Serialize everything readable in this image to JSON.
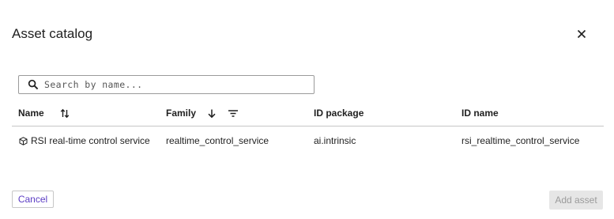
{
  "dialog": {
    "title": "Asset catalog",
    "close_icon": "close-icon"
  },
  "search": {
    "placeholder": "Search by name...",
    "value": "",
    "icon": "search-icon"
  },
  "table": {
    "columns": [
      {
        "label": "Name",
        "icon": "sort-both-icon"
      },
      {
        "label": "Family",
        "icons": [
          "arrow-down-icon",
          "filter-icon"
        ]
      },
      {
        "label": "ID package"
      },
      {
        "label": "ID name"
      }
    ],
    "rows": [
      {
        "icon": "cube-icon",
        "name": "RSI real-time control service",
        "family": "realtime_control_service",
        "id_package": "ai.intrinsic",
        "id_name": "rsi_realtime_control_service"
      }
    ]
  },
  "footer": {
    "cancel_label": "Cancel",
    "add_label": "Add asset"
  },
  "colors": {
    "accent": "#5b3cc4",
    "disabled_bg": "#e6e6e6",
    "disabled_text": "#9b9b9b",
    "divider": "#c7c7c7"
  }
}
